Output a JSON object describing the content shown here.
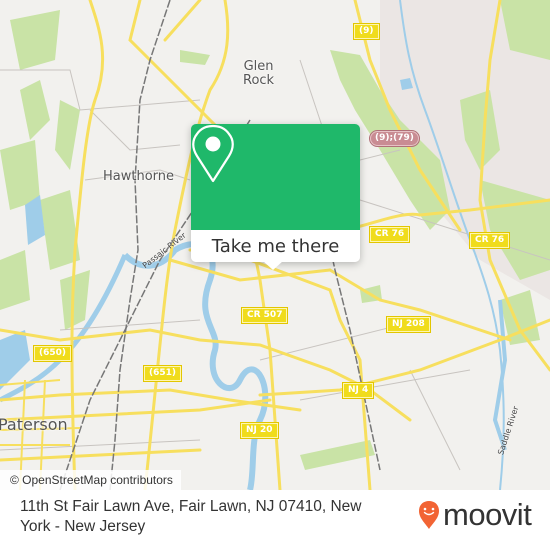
{
  "map": {
    "places": [
      {
        "id": "glen-rock",
        "label": "Glen\nRock"
      },
      {
        "id": "hawthorne",
        "label": "Hawthorne"
      },
      {
        "id": "paterson",
        "label": "Paterson"
      }
    ],
    "shields": [
      {
        "id": "route-9",
        "label": "(9)"
      },
      {
        "id": "route-9-79",
        "label": "(9);(79)"
      },
      {
        "id": "cr-76-a",
        "label": "CR 76"
      },
      {
        "id": "cr-76-b",
        "label": "CR 76"
      },
      {
        "id": "cr-507",
        "label": "CR 507"
      },
      {
        "id": "nj-208",
        "label": "NJ 208"
      },
      {
        "id": "route-650",
        "label": "(650)"
      },
      {
        "id": "route-651",
        "label": "(651)"
      },
      {
        "id": "nj-4",
        "label": "NJ 4"
      },
      {
        "id": "nj-20",
        "label": "NJ 20"
      }
    ],
    "rivers": [
      {
        "id": "passaic-river",
        "label": "Passaic River"
      },
      {
        "id": "saddle-river",
        "label": "Saddle River"
      }
    ],
    "attribution": "© OpenStreetMap contributors",
    "colors": {
      "background": "#f2f1ee",
      "road": "#f7df5e",
      "water": "#9fcde9",
      "park": "#c9e3a6",
      "rail": "#777777"
    }
  },
  "popup": {
    "icon": "map-pin-icon",
    "button_label": "Take me there",
    "accent_color": "#1fb86a"
  },
  "footer": {
    "address": "11th St Fair Lawn Ave, Fair Lawn, NJ 07410, New York - New Jersey",
    "brand": "moovit",
    "brand_icon": "moovit-smile-pin-icon",
    "brand_color": "#f26434"
  }
}
